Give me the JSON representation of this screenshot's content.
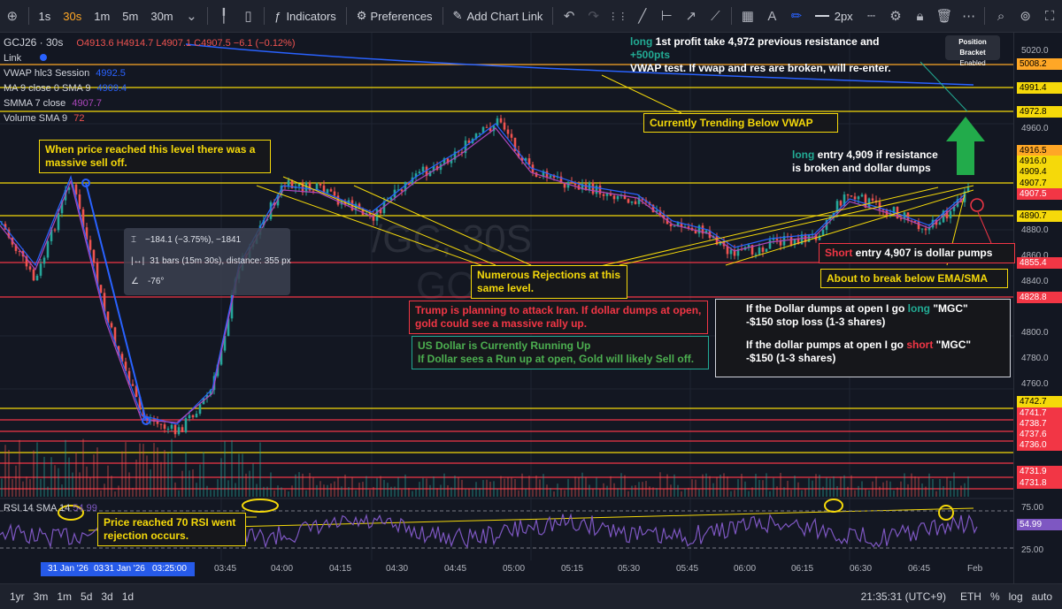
{
  "toolbar": {
    "intervals": [
      "1s",
      "30s",
      "1m",
      "5m",
      "30m"
    ],
    "active_interval": "30s",
    "indicators_label": "Indicators",
    "preferences_label": "Preferences",
    "add_chart_link_label": "Add Chart Link",
    "line_width_label": "2px"
  },
  "legend": {
    "symbol": "GCJ26 · 30s",
    "ohlc": "O4913.6 H4914.7 L4907.1 C4907.5 −6.1 (−0.12%)",
    "link": "Link",
    "vwap_name": "VWAP hlc3 Session",
    "vwap_value": "4992.5",
    "ma_name": "MA 9 close 0 SMA 9",
    "ma_value": "4909.4",
    "smma_name": "SMMA 7 close",
    "smma_value": "4907.7",
    "volume_name": "Volume SMA 9",
    "volume_value": "72",
    "rsi_name": "RSI 14 SMA 14",
    "rsi_value": "54.99"
  },
  "watermark": {
    "line1": "/GC, 30S",
    "line2": "GCJ26"
  },
  "position_bracket": {
    "title": "Position Bracket",
    "status": "Enabled"
  },
  "annotations": {
    "sell_off": "When price reached this level there was a massive sell off.",
    "trending_below_vwap": "Currently Trending Below VWAP",
    "rejections": "Numerous Rejections at this same level.",
    "iran": "Trump is planning to attack Iran. If dollar dumps at open, gold could see a massive rally up.",
    "dollar_line1": "US Dollar is Currently Running Up",
    "dollar_line2": "If Dollar sees a Run up at open, Gold will likely Sell off.",
    "long_profit_word": "long",
    "long_profit_text": " 1st profit take 4,972 previous resistance and ",
    "long_profit_pts": "+500pts",
    "long_profit_line2": "VWAP test. If vwap and res are broken, will re-enter.",
    "long_entry_word": "long",
    "long_entry_text": " entry 4,909 if resistance",
    "long_entry_line2": "is broken and dollar dumps",
    "short_entry_word": "Short",
    "short_entry_text": " entry 4,907 is dollar pumps",
    "ema_sma": "About to break below EMA/SMA",
    "plan_long_a": "If the Dollar dumps at open I go ",
    "plan_long_word": "long",
    "plan_long_b": " \"MGC\"",
    "plan_long_line2": "-$150 stop loss (1-3 shares)",
    "plan_short_a": "If the dollar pumps at open I go ",
    "plan_short_word": "short",
    "plan_short_b": " \"MGC\"",
    "plan_short_line2": "-$150 (1-3 shares)",
    "rsi_note": "Price reached 70 RSI went rejection occurs."
  },
  "measure_tool": {
    "price_change": "−184.1 (−3.75%), −1841",
    "bars": "31 bars (15m 30s), distance: 355 px",
    "angle": "-76°"
  },
  "price_labels": [
    {
      "text": "5008.2",
      "color": "#ffa726"
    },
    {
      "text": "4991.4",
      "color": "#f5d90a"
    },
    {
      "text": "4972.8",
      "color": "#f5d90a"
    },
    {
      "text": "4916.5",
      "color": "#ffa726"
    },
    {
      "text": "4916.0",
      "color": "#f5d90a"
    },
    {
      "text": "4909.4",
      "color": "#f5d90a"
    },
    {
      "text": "4907.7",
      "color": "#f5d90a"
    },
    {
      "text": "4907.5",
      "color": "#f23645"
    },
    {
      "text": "4890.7",
      "color": "#f5d90a"
    },
    {
      "text": "4855.4",
      "color": "#f23645"
    },
    {
      "text": "4828.8",
      "color": "#f23645"
    },
    {
      "text": "4742.7",
      "color": "#f5d90a"
    },
    {
      "text": "4741.7",
      "color": "#f23645"
    },
    {
      "text": "4738.7",
      "color": "#f23645"
    },
    {
      "text": "4737.6",
      "color": "#f23645"
    },
    {
      "text": "4736.0",
      "color": "#f23645"
    },
    {
      "text": "4731.9",
      "color": "#f23645"
    },
    {
      "text": "4731.8",
      "color": "#f23645"
    }
  ],
  "price_ticks": [
    "5020.0",
    "4960.0",
    "4880.0",
    "4860.0",
    "4840.0",
    "4800.0",
    "4780.0",
    "4760.0"
  ],
  "rsi_ticks": [
    "75.00",
    "25.00"
  ],
  "rsi_label": "54.99",
  "time_labels": [
    "31 Jan '26",
    "03",
    "31 Jan '26",
    "03:25:00",
    "03:45",
    "04:00",
    "04:15",
    "04:30",
    "04:45",
    "05:00",
    "05:15",
    "05:30",
    "05:45",
    "06:00",
    "06:15",
    "06:30",
    "06:45",
    "Feb"
  ],
  "bottombar": {
    "ranges": [
      "1yr",
      "3m",
      "1m",
      "5d",
      "3d",
      "1d"
    ],
    "clock": "21:35:31 (UTC+9)",
    "eth": "ETH",
    "percent": "%",
    "log": "log",
    "auto": "auto"
  },
  "colors": {
    "background": "#131722",
    "support": "#f23645",
    "resistance": "#f5d90a",
    "up_candle": "#26a69a",
    "down_candle": "#ef5350",
    "vwap": "#2962ff",
    "rsi": "#7e57c2"
  }
}
